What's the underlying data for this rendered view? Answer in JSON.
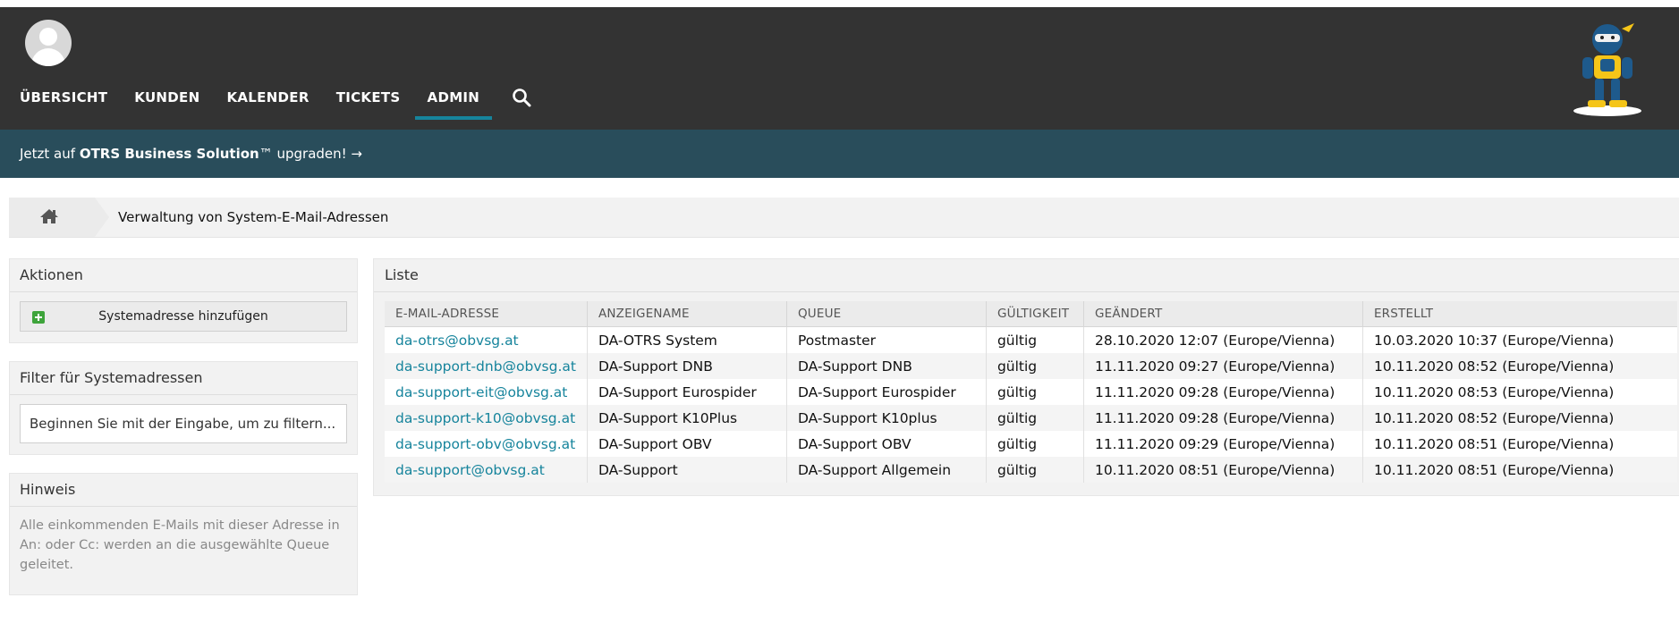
{
  "header": {
    "nav": [
      {
        "label": "ÜBERSICHT",
        "active": false
      },
      {
        "label": "KUNDEN",
        "active": false
      },
      {
        "label": "KALENDER",
        "active": false
      },
      {
        "label": "TICKETS",
        "active": false
      },
      {
        "label": "ADMIN",
        "active": true
      }
    ],
    "search_icon": "search-icon",
    "avatar_icon": "user-avatar-icon",
    "logo_icon": "otrs-ninja-mascot"
  },
  "upgrade_bar": {
    "prefix": "Jetzt auf ",
    "product": "OTRS Business Solution",
    "tm": "™",
    "suffix": " upgraden! →"
  },
  "breadcrumb": {
    "home_icon": "home-icon",
    "current": "Verwaltung von System-E-Mail-Adressen"
  },
  "sidebar": {
    "actions": {
      "title": "Aktionen",
      "add_button": "Systemadresse hinzufügen"
    },
    "filter": {
      "title": "Filter für Systemadressen",
      "placeholder": "Beginnen Sie mit der Eingabe, um zu filtern..."
    },
    "hint": {
      "title": "Hinweis",
      "text": "Alle einkommenden E-Mails mit dieser Adresse in An: oder Cc: werden an die ausgewählte Queue geleitet."
    }
  },
  "list": {
    "title": "Liste",
    "columns": [
      "E-MAIL-ADRESSE",
      "ANZEIGENAME",
      "QUEUE",
      "GÜLTIGKEIT",
      "GEÄNDERT",
      "ERSTELLT"
    ],
    "rows": [
      [
        "da-otrs@obvsg.at",
        "DA-OTRS System",
        "Postmaster",
        "gültig",
        "28.10.2020 12:07 (Europe/Vienna)",
        "10.03.2020 10:37 (Europe/Vienna)"
      ],
      [
        "da-support-dnb@obvsg.at",
        "DA-Support DNB",
        "DA-Support DNB",
        "gültig",
        "11.11.2020 09:27 (Europe/Vienna)",
        "10.11.2020 08:52 (Europe/Vienna)"
      ],
      [
        "da-support-eit@obvsg.at",
        "DA-Support Eurospider",
        "DA-Support Eurospider",
        "gültig",
        "11.11.2020 09:28 (Europe/Vienna)",
        "10.11.2020 08:53 (Europe/Vienna)"
      ],
      [
        "da-support-k10@obvsg.at",
        "DA-Support K10Plus",
        "DA-Support K10plus",
        "gültig",
        "11.11.2020 09:28 (Europe/Vienna)",
        "10.11.2020 08:52 (Europe/Vienna)"
      ],
      [
        "da-support-obv@obvsg.at",
        "DA-Support OBV",
        "DA-Support OBV",
        "gültig",
        "11.11.2020 09:29 (Europe/Vienna)",
        "10.11.2020 08:51 (Europe/Vienna)"
      ],
      [
        "da-support@obvsg.at",
        "DA-Support",
        "DA-Support Allgemein",
        "gültig",
        "10.11.2020 08:51 (Europe/Vienna)",
        "10.11.2020 08:51 (Europe/Vienna)"
      ]
    ]
  },
  "colors": {
    "header_bg": "#333333",
    "upgrade_bg": "#294d5b",
    "accent": "#16849c",
    "add_icon": "#3ea43b"
  }
}
